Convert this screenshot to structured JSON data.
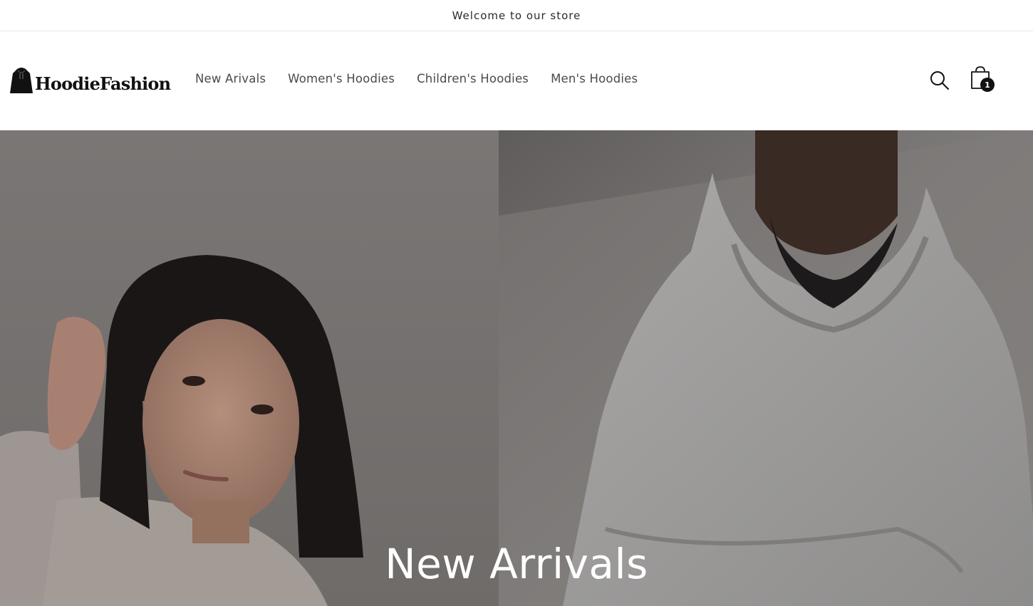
{
  "announcement": {
    "text": "Welcome to our store"
  },
  "header": {
    "logo_text": "HoodieFashion",
    "nav": [
      {
        "label": "New Arivals"
      },
      {
        "label": "Women's Hoodies"
      },
      {
        "label": "Children's Hoodies"
      },
      {
        "label": "Men's Hoodies"
      }
    ],
    "cart_count": "1",
    "icons": {
      "search": "search-icon",
      "cart": "shopping-bag-icon",
      "logo": "hoodie-logo-icon"
    }
  },
  "hero": {
    "title": "New Arrivals",
    "overlay_color": "#000000"
  },
  "colors": {
    "text": "#121212",
    "nav_text": "#4a4a4a",
    "badge": "#121212"
  }
}
